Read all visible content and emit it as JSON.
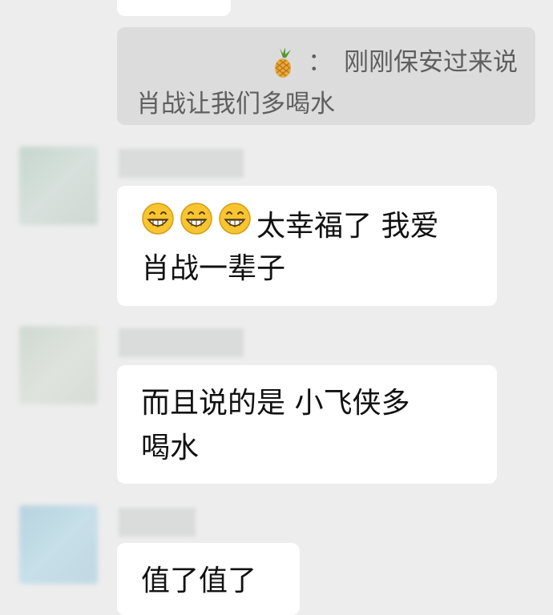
{
  "quote": {
    "separator": "：",
    "line1": "刚刚保安过来说",
    "line2": "肖战让我们多喝水"
  },
  "messages": [
    {
      "line1": "太幸福了 我爱",
      "line2": "肖战一辈子"
    },
    {
      "line1": "而且说的是 小飞侠多",
      "line2": "喝水"
    },
    {
      "line1": "值了值了"
    }
  ],
  "icons": {
    "quote_author": "pineapple-icon",
    "emoji": "grin-emoji"
  },
  "colors": {
    "background": "#ededed",
    "bubble": "#ffffff",
    "quote_bg": "#dcdcdc",
    "quote_text": "#5f5f5f",
    "message_text": "#111111"
  }
}
